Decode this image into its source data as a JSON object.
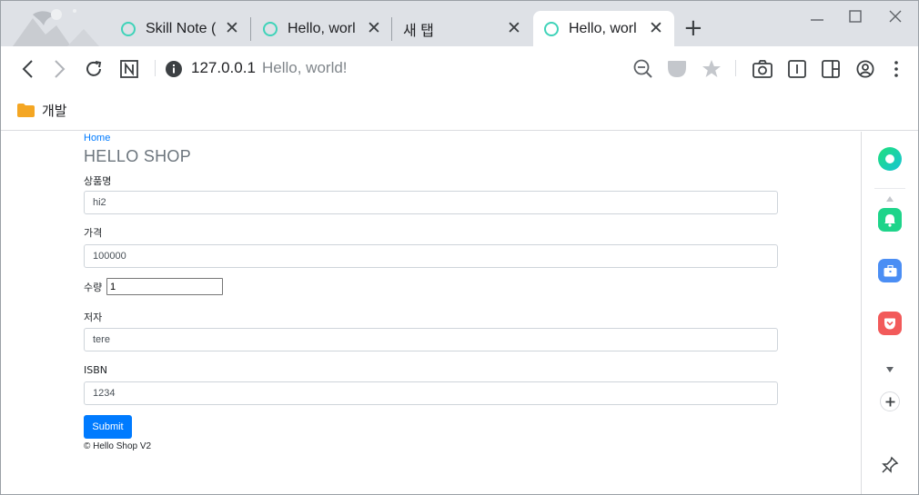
{
  "browser": {
    "tabs": [
      {
        "title": "Skill Note (",
        "active": false
      },
      {
        "title": "Hello, worl",
        "active": false
      },
      {
        "title": "새 탭",
        "active": false
      },
      {
        "title": "Hello, worl",
        "active": true
      }
    ],
    "new_tab_icon": "plus-icon",
    "address": {
      "host": "127.0.0.1",
      "page_title": "Hello, world!"
    },
    "bookmarks": [
      {
        "label": "개발",
        "icon": "folder-icon"
      }
    ]
  },
  "page": {
    "breadcrumb": "Home",
    "title": "HELLO SHOP",
    "fields": {
      "name": {
        "label": "상품명",
        "value": "hi2"
      },
      "price": {
        "label": "가격",
        "value": "100000"
      },
      "quantity": {
        "label": "수량",
        "value": "1"
      },
      "author": {
        "label": "저자",
        "value": "tere"
      },
      "isbn": {
        "label": "ISBN",
        "value": "1234"
      }
    },
    "submit_label": "Submit",
    "footer": "© Hello Shop V2"
  },
  "colors": {
    "accent": "#007bff",
    "tab_ring": "#3fd3b9",
    "tabstrip_bg": "#dee1e6"
  }
}
